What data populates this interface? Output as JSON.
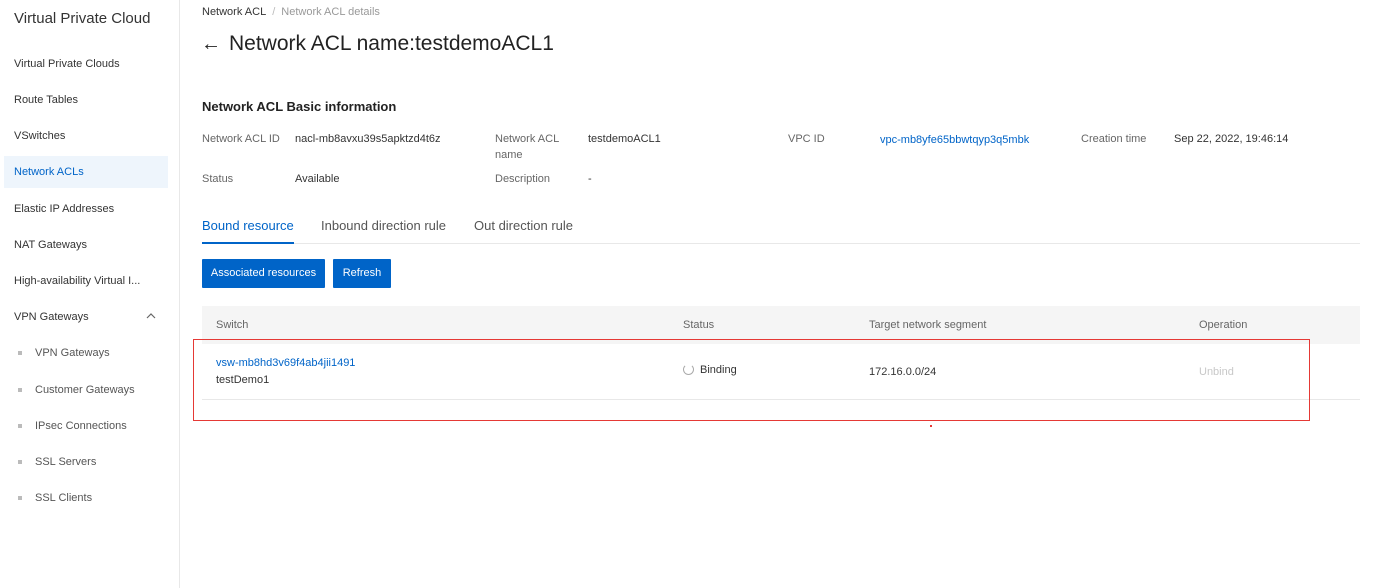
{
  "sidebar": {
    "title": "Virtual Private Cloud",
    "items": [
      {
        "label": "Virtual Private Clouds"
      },
      {
        "label": "Route Tables"
      },
      {
        "label": "VSwitches"
      },
      {
        "label": "Network ACLs"
      },
      {
        "label": "Elastic IP Addresses"
      },
      {
        "label": "NAT Gateways"
      },
      {
        "label": "High-availability Virtual I..."
      },
      {
        "label": "VPN Gateways",
        "icon": "chevron-up-icon"
      }
    ],
    "vpn_sub_items": [
      {
        "label": "VPN Gateways"
      },
      {
        "label": "Customer Gateways"
      },
      {
        "label": "IPsec Connections"
      },
      {
        "label": "SSL Servers"
      },
      {
        "label": "SSL Clients"
      }
    ],
    "active_item": "Network ACLs"
  },
  "breadcrumb": {
    "parent": "Network ACL",
    "separator": "/",
    "current": "Network ACL details"
  },
  "header": {
    "back_icon": "←",
    "title": "Network ACL name:testdemoACL1"
  },
  "basic_info": {
    "section_title": "Network ACL Basic information",
    "network_acl_id_label": "Network ACL ID",
    "network_acl_id": "nacl-mb8avxu39s5apktzd4t6z",
    "network_acl_name_label_1": "Network ACL",
    "network_acl_name_label_2": "name",
    "network_acl_name": "testdemoACL1",
    "vpc_id_label": "VPC ID",
    "vpc_id": "vpc-mb8yfe65bbwtqyp3q5mbk",
    "creation_time_label": "Creation time",
    "creation_time": "Sep 22, 2022, 19:46:14",
    "status_label": "Status",
    "status": "Available",
    "description_label": "Description",
    "description": "-"
  },
  "tabs": [
    {
      "label": "Bound resource",
      "active": true
    },
    {
      "label": "Inbound direction rule",
      "active": false
    },
    {
      "label": "Out direction rule",
      "active": false
    }
  ],
  "toolbar": {
    "associated_label": "Associated resources",
    "refresh_label": "Refresh"
  },
  "table": {
    "columns": [
      "Switch",
      "Status",
      "Target network segment",
      "Operation"
    ],
    "rows": [
      {
        "switch_id": "vsw-mb8hd3v69f4ab4jii1491",
        "switch_name": "testDemo1",
        "status": "Binding",
        "target_segment": "172.16.0.0/24",
        "operation": "Unbind"
      }
    ]
  },
  "colors": {
    "accent": "#0064c8",
    "highlight": "#e53935",
    "active_bg": "#eef5fc"
  }
}
